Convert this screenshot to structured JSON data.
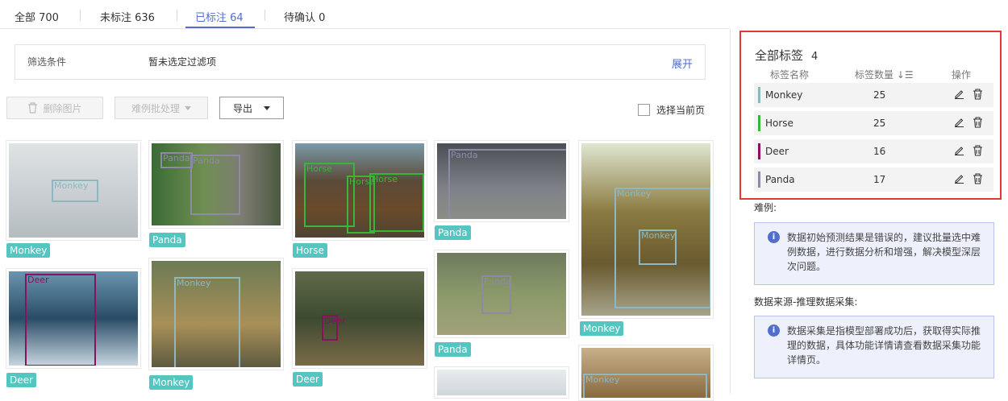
{
  "tabs": [
    {
      "label": "全部 700"
    },
    {
      "label": "未标注 636"
    },
    {
      "label": "已标注 64"
    },
    {
      "label": "待确认 0"
    }
  ],
  "filter": {
    "key": "筛选条件",
    "value": "暂未选定过滤项",
    "expand": "展开"
  },
  "toolbar": {
    "delete_label": "删除图片",
    "hard_label": "难例批处理",
    "export_label": "导出",
    "select_page": "选择当前页"
  },
  "images": [
    {
      "tag": "Monkey",
      "boxes": [
        {
          "label": "Monkey"
        }
      ]
    },
    {
      "tag": "Deer",
      "boxes": [
        {
          "label": "Deer"
        }
      ]
    },
    {
      "tag": "Panda",
      "boxes": [
        {
          "label": "Panda"
        },
        {
          "label": "Panda"
        }
      ]
    },
    {
      "tag": "Monkey",
      "boxes": [
        {
          "label": "Monkey"
        }
      ]
    },
    {
      "tag": "Horse",
      "boxes": [
        {
          "label": "Horse"
        },
        {
          "label": "Horse"
        },
        {
          "label": "Horse"
        }
      ]
    },
    {
      "tag": "Deer",
      "boxes": [
        {
          "label": "Deer"
        }
      ]
    },
    {
      "tag": "Panda",
      "boxes": [
        {
          "label": "Panda"
        }
      ]
    },
    {
      "tag": "Panda",
      "boxes": [
        {
          "label": "Panda"
        }
      ]
    },
    {
      "tag": "",
      "boxes": []
    },
    {
      "tag": "Monkey",
      "boxes": [
        {
          "label": "Monkey"
        },
        {
          "label": "Monkey"
        }
      ]
    },
    {
      "tag": "",
      "boxes": [
        {
          "label": "Monkey"
        }
      ]
    }
  ],
  "labels_panel": {
    "title": "全部标签",
    "count": "4",
    "col_name": "标签名称",
    "col_count": "标签数量",
    "col_ops": "操作",
    "rows": [
      {
        "name": "Monkey",
        "count": "25",
        "color": "#8eb7c0"
      },
      {
        "name": "Horse",
        "count": "25",
        "color": "#3ab53a"
      },
      {
        "name": "Deer",
        "count": "16",
        "color": "#8a1060"
      },
      {
        "name": "Panda",
        "count": "17",
        "color": "#8e8aa6"
      }
    ]
  },
  "hard_example": {
    "title": "难例:",
    "text": "数据初始预测结果是错误的，建议批量选中难例数据，进行数据分析和增强，解决模型深层次问题。"
  },
  "data_source": {
    "title": "数据来源-推理数据采集:",
    "text": "数据采集是指模型部署成功后，获取得实际推理的数据，具体功能详情请查看数据采集功能详情页。"
  },
  "colors": {
    "accent": "#526ecc",
    "tag": "#53c6c2",
    "highlight": "#e53935"
  }
}
